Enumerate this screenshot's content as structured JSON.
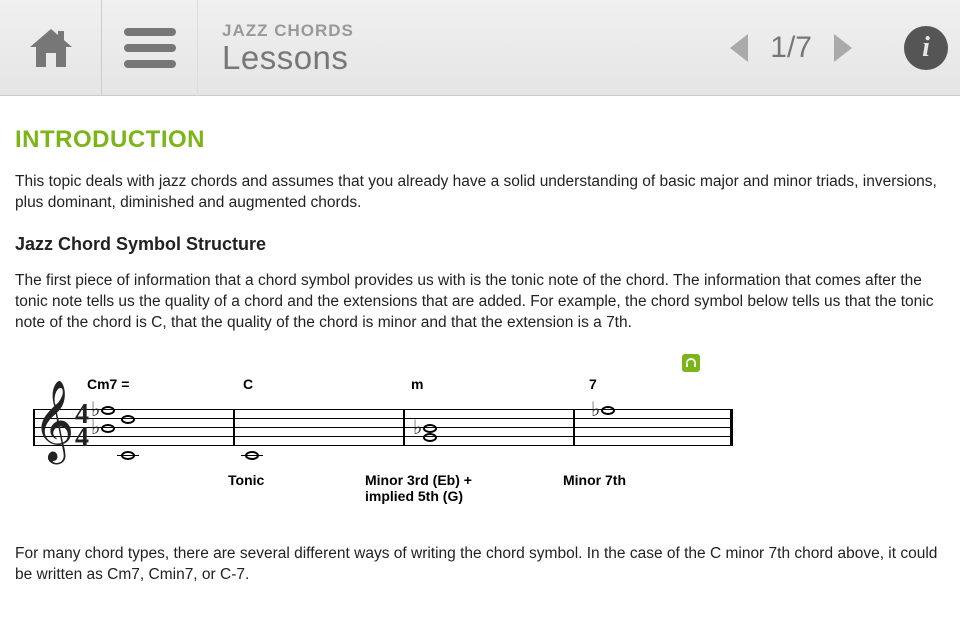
{
  "header": {
    "breadcrumb": "JAZZ CHORDS",
    "title": "Lessons",
    "page_indicator": "1/7"
  },
  "section": {
    "heading": "INTRODUCTION",
    "intro_paragraph": "This topic deals with jazz chords and assumes that you already have a solid understanding of basic major and minor triads, inversions, plus dominant, diminished and augmented chords.",
    "sub_heading": "Jazz Chord Symbol Structure",
    "paragraph_2": "The first piece of information that a chord symbol provides us with is the tonic note of the chord. The information that comes after the tonic note tells us the quality of a chord and the extensions that are added. For example, the chord symbol below tells us that the tonic note of the chord is C, that the quality of the chord is minor and that the extension is a 7th.",
    "paragraph_3": "For many chord types, there are several different ways of writing the chord symbol. In the case of the C minor 7th chord above, it could be written as Cm7, Cmin7, or C-7."
  },
  "notation": {
    "measure1_label": "Cm7  =",
    "measure2_label": "C",
    "measure3_label": "m",
    "measure4_label": "7",
    "desc1": "Tonic",
    "desc2": "Minor 3rd (Eb) + implied 5th (G)",
    "desc3": "Minor 7th",
    "time_top": "4",
    "time_bot": "4",
    "clef": "𝄞"
  }
}
